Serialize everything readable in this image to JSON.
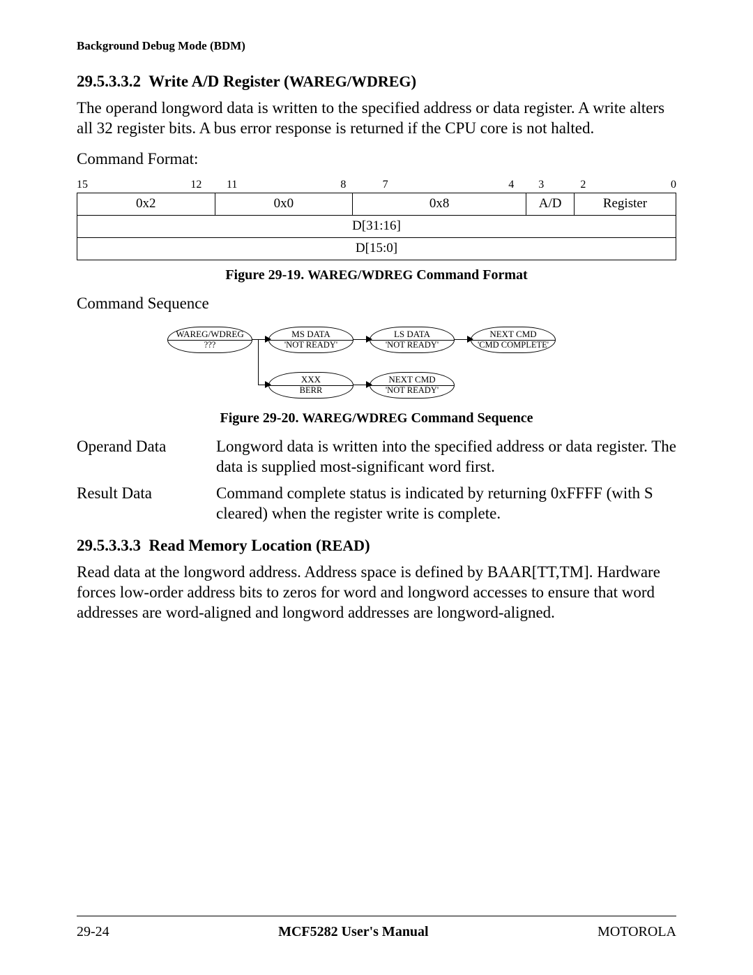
{
  "running_head": "Background Debug Mode (BDM)",
  "section1": {
    "number": "29.5.3.3.2",
    "title_plain": "Write A/D Register (",
    "title_sc": "WAREG/WDREG",
    "title_close": ")",
    "para": "The operand longword data is written to the specified address or data register. A write alters all 32 register bits. A bus error response is returned if the CPU core is not halted.",
    "cmd_format_label": "Command Format:"
  },
  "bit_labels": [
    "15",
    "12",
    "11",
    "8",
    "7",
    "4",
    "3",
    "2",
    "0"
  ],
  "bit_row1": [
    "0x2",
    "0x0",
    "0x8",
    "A/D",
    "Register"
  ],
  "bit_row2": "D[31:16]",
  "bit_row3": "D[15:0]",
  "fig19": {
    "prefix": "Figure 29-19. ",
    "sc": "WAREG/WDREG",
    "suffix": " Command Format"
  },
  "cmd_sequence_label": "Command Sequence",
  "bubbles": {
    "b1_top": "WAREG/WDREG",
    "b1_bot": "???",
    "b2_top": "MS DATA",
    "b2_bot": "'NOT READY'",
    "b3_top": "LS DATA",
    "b3_bot": "'NOT READY'",
    "b4_top": "NEXT CMD",
    "b4_bot": "'CMD COMPLETE'",
    "b5_top": "XXX",
    "b5_bot": "BERR",
    "b6_top": "NEXT CMD",
    "b6_bot": "'NOT READY'"
  },
  "fig20": {
    "prefix": "Figure 29-20. ",
    "sc": "WAREG/WDREG",
    "suffix": " Command Sequence"
  },
  "defs": {
    "operand_term": "Operand Data",
    "operand_desc": "Longword data is written into the specified address or data register. The data is supplied most-significant word first.",
    "result_term": "Result Data",
    "result_desc": "Command complete status is indicated by returning 0xFFFF (with S cleared) when the register write is complete."
  },
  "section2": {
    "number": "29.5.3.3.3",
    "title_plain": "Read Memory Location (",
    "title_sc": "READ",
    "title_close": ")",
    "para": "Read data at the longword address. Address space is defined by BAAR[TT,TM]. Hardware forces low-order address bits to zeros for word and longword accesses to ensure that word addresses are word-aligned and longword addresses are longword-aligned."
  },
  "footer": {
    "left": "29-24",
    "center": "MCF5282 User's Manual",
    "right": "MOTOROLA"
  }
}
